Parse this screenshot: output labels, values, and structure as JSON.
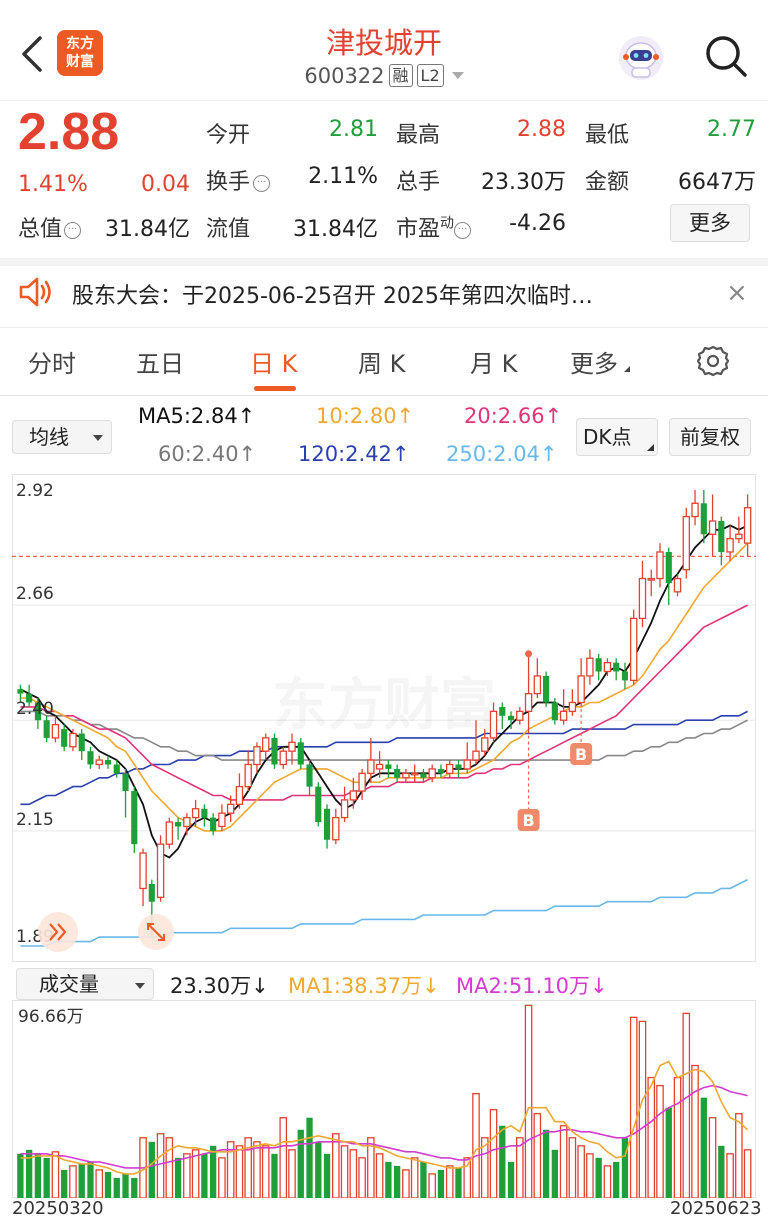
{
  "header": {
    "logo_line1": "东方",
    "logo_line2": "财富",
    "title": "津投城开",
    "code": "600322",
    "tag1": "融",
    "tag2": "L2"
  },
  "quote": {
    "price": "2.88",
    "change_pct": "1.41%",
    "change_amt": "0.04",
    "open_label": "今开",
    "open": "2.81",
    "high_label": "最高",
    "high": "2.88",
    "low_label": "最低",
    "low": "2.77",
    "turnover_label": "换手",
    "turnover": "2.11%",
    "volume_label": "总手",
    "volume": "23.30万",
    "amount_label": "金额",
    "amount": "6647万",
    "mktcap_label": "总值",
    "mktcap": "31.84亿",
    "float_label": "流值",
    "float": "31.84亿",
    "pe_label": "市盈",
    "pe_sup": "动",
    "pe": "-4.26",
    "more_label": "更多"
  },
  "notice": {
    "text": "股东大会：于2025-06-25召开 2025年第四次临时…",
    "close": "×"
  },
  "tabs": [
    {
      "label": "分时"
    },
    {
      "label": "五日"
    },
    {
      "label": "日 K"
    },
    {
      "label": "周 K"
    },
    {
      "label": "月 K"
    },
    {
      "label": "更多"
    }
  ],
  "ma_bar": {
    "select_label": "均线",
    "ma5": "MA5:2.84↑",
    "ma10": "10:2.80↑",
    "ma20": "20:2.66↑",
    "ma60": "60:2.40↑",
    "ma120": "120:2.42↑",
    "ma250": "250:2.04↑",
    "dk_label": "DK点",
    "fq_label": "前复权",
    "colors": {
      "ma5": "#111111",
      "ma10": "#f0a830",
      "ma20": "#e0337a",
      "ma60": "#888888",
      "ma120": "#2b3fae",
      "ma250": "#6ab8ea"
    }
  },
  "chart_data": {
    "type": "candlestick",
    "y_ticks": [
      "2.92",
      "2.66",
      "2.40",
      "2.15",
      "1.89"
    ],
    "ylim": [
      1.89,
      2.92
    ],
    "current_price": 2.77,
    "watermark": "东方财富",
    "marker_label": "B",
    "candles": [
      [
        2.47,
        2.46,
        2.48,
        2.44
      ],
      [
        2.46,
        2.44,
        2.48,
        2.43
      ],
      [
        2.44,
        2.4,
        2.45,
        2.38
      ],
      [
        2.4,
        2.36,
        2.41,
        2.35
      ],
      [
        2.36,
        2.39,
        2.41,
        2.35
      ],
      [
        2.38,
        2.34,
        2.39,
        2.33
      ],
      [
        2.34,
        2.37,
        2.38,
        2.33
      ],
      [
        2.37,
        2.33,
        2.38,
        2.31
      ],
      [
        2.33,
        2.3,
        2.34,
        2.29
      ],
      [
        2.3,
        2.31,
        2.32,
        2.29
      ],
      [
        2.31,
        2.3,
        2.32,
        2.29
      ],
      [
        2.3,
        2.28,
        2.31,
        2.27
      ],
      [
        2.28,
        2.24,
        2.29,
        2.18
      ],
      [
        2.24,
        2.12,
        2.25,
        2.1
      ],
      [
        2.02,
        2.1,
        2.11,
        1.98
      ],
      [
        2.03,
        1.99,
        2.04,
        1.91
      ],
      [
        2.0,
        2.12,
        2.14,
        1.99
      ],
      [
        2.12,
        2.17,
        2.18,
        2.11
      ],
      [
        2.17,
        2.16,
        2.18,
        2.13
      ],
      [
        2.16,
        2.18,
        2.19,
        2.14
      ],
      [
        2.18,
        2.2,
        2.22,
        2.16
      ],
      [
        2.2,
        2.18,
        2.21,
        2.16
      ],
      [
        2.18,
        2.15,
        2.19,
        2.14
      ],
      [
        2.16,
        2.19,
        2.21,
        2.15
      ],
      [
        2.19,
        2.21,
        2.23,
        2.17
      ],
      [
        2.21,
        2.25,
        2.28,
        2.2
      ],
      [
        2.25,
        2.3,
        2.33,
        2.24
      ],
      [
        2.3,
        2.34,
        2.35,
        2.28
      ],
      [
        2.33,
        2.36,
        2.37,
        2.31
      ],
      [
        2.36,
        2.3,
        2.37,
        2.29
      ],
      [
        2.3,
        2.33,
        2.34,
        2.29
      ],
      [
        2.33,
        2.35,
        2.37,
        2.3
      ],
      [
        2.35,
        2.3,
        2.36,
        2.29
      ],
      [
        2.3,
        2.25,
        2.31,
        2.23
      ],
      [
        2.25,
        2.17,
        2.26,
        2.16
      ],
      [
        2.2,
        2.13,
        2.21,
        2.11
      ],
      [
        2.13,
        2.18,
        2.2,
        2.12
      ],
      [
        2.18,
        2.22,
        2.25,
        2.17
      ],
      [
        2.22,
        2.24,
        2.27,
        2.2
      ],
      [
        2.24,
        2.28,
        2.29,
        2.22
      ],
      [
        2.28,
        2.31,
        2.36,
        2.26
      ],
      [
        2.29,
        2.3,
        2.33,
        2.27
      ],
      [
        2.3,
        2.29,
        2.31,
        2.27
      ],
      [
        2.29,
        2.27,
        2.3,
        2.26
      ],
      [
        2.27,
        2.28,
        2.29,
        2.26
      ],
      [
        2.28,
        2.28,
        2.3,
        2.26
      ],
      [
        2.28,
        2.27,
        2.29,
        2.26
      ],
      [
        2.27,
        2.29,
        2.3,
        2.26
      ],
      [
        2.29,
        2.28,
        2.3,
        2.27
      ],
      [
        2.28,
        2.3,
        2.31,
        2.27
      ],
      [
        2.3,
        2.29,
        2.31,
        2.27
      ],
      [
        2.29,
        2.31,
        2.35,
        2.28
      ],
      [
        2.31,
        2.33,
        2.4,
        2.3
      ],
      [
        2.33,
        2.36,
        2.38,
        2.32
      ],
      [
        2.36,
        2.42,
        2.44,
        2.35
      ],
      [
        2.43,
        2.41,
        2.44,
        2.38
      ],
      [
        2.41,
        2.4,
        2.42,
        2.38
      ],
      [
        2.4,
        2.42,
        2.43,
        2.39
      ],
      [
        2.42,
        2.46,
        2.55,
        2.37
      ],
      [
        2.46,
        2.5,
        2.54,
        2.45
      ],
      [
        2.5,
        2.44,
        2.51,
        2.43
      ],
      [
        2.44,
        2.4,
        2.45,
        2.39
      ],
      [
        2.4,
        2.42,
        2.47,
        2.39
      ],
      [
        2.42,
        2.44,
        2.47,
        2.41
      ],
      [
        2.44,
        2.5,
        2.54,
        2.43
      ],
      [
        2.5,
        2.54,
        2.56,
        2.48
      ],
      [
        2.54,
        2.51,
        2.55,
        2.49
      ],
      [
        2.51,
        2.53,
        2.54,
        2.5
      ],
      [
        2.53,
        2.51,
        2.54,
        2.49
      ],
      [
        2.51,
        2.49,
        2.53,
        2.47
      ],
      [
        2.49,
        2.63,
        2.65,
        2.48
      ],
      [
        2.63,
        2.72,
        2.76,
        2.61
      ],
      [
        2.72,
        2.72,
        2.74,
        2.68
      ],
      [
        2.72,
        2.78,
        2.8,
        2.7
      ],
      [
        2.78,
        2.71,
        2.79,
        2.66
      ],
      [
        2.69,
        2.72,
        2.73,
        2.68
      ],
      [
        2.74,
        2.86,
        2.88,
        2.72
      ],
      [
        2.86,
        2.89,
        2.92,
        2.84
      ],
      [
        2.89,
        2.82,
        2.92,
        2.8
      ],
      [
        2.82,
        2.85,
        2.91,
        2.77
      ],
      [
        2.85,
        2.78,
        2.86,
        2.75
      ],
      [
        2.78,
        2.81,
        2.84,
        2.76
      ],
      [
        2.81,
        2.82,
        2.86,
        2.8
      ],
      [
        2.8,
        2.88,
        2.91,
        2.77
      ]
    ],
    "ma5": [
      2.47,
      2.46,
      2.45,
      2.42,
      2.41,
      2.39,
      2.37,
      2.36,
      2.35,
      2.33,
      2.32,
      2.31,
      2.29,
      2.25,
      2.21,
      2.14,
      2.1,
      2.09,
      2.11,
      2.15,
      2.17,
      2.18,
      2.17,
      2.18,
      2.19,
      2.21,
      2.24,
      2.28,
      2.31,
      2.33,
      2.34,
      2.34,
      2.34,
      2.31,
      2.28,
      2.25,
      2.22,
      2.2,
      2.21,
      2.24,
      2.27,
      2.28,
      2.28,
      2.28,
      2.28,
      2.28,
      2.28,
      2.28,
      2.28,
      2.29,
      2.29,
      2.29,
      2.3,
      2.32,
      2.35,
      2.37,
      2.39,
      2.41,
      2.42,
      2.44,
      2.44,
      2.44,
      2.43,
      2.43,
      2.44,
      2.46,
      2.48,
      2.51,
      2.52,
      2.51,
      2.54,
      2.58,
      2.62,
      2.67,
      2.71,
      2.73,
      2.76,
      2.79,
      2.81,
      2.83,
      2.83,
      2.84,
      2.83,
      2.84
    ],
    "ma10": [
      2.45,
      2.45,
      2.44,
      2.43,
      2.42,
      2.41,
      2.4,
      2.39,
      2.38,
      2.37,
      2.36,
      2.34,
      2.33,
      2.3,
      2.27,
      2.24,
      2.22,
      2.2,
      2.18,
      2.17,
      2.16,
      2.15,
      2.15,
      2.15,
      2.16,
      2.18,
      2.2,
      2.22,
      2.24,
      2.26,
      2.27,
      2.28,
      2.29,
      2.29,
      2.29,
      2.29,
      2.28,
      2.27,
      2.26,
      2.26,
      2.26,
      2.26,
      2.27,
      2.27,
      2.27,
      2.27,
      2.27,
      2.27,
      2.27,
      2.28,
      2.28,
      2.28,
      2.29,
      2.3,
      2.31,
      2.33,
      2.35,
      2.36,
      2.38,
      2.39,
      2.4,
      2.41,
      2.42,
      2.43,
      2.43,
      2.44,
      2.44,
      2.45,
      2.46,
      2.47,
      2.48,
      2.5,
      2.53,
      2.56,
      2.58,
      2.61,
      2.64,
      2.67,
      2.7,
      2.72,
      2.74,
      2.76,
      2.78,
      2.8
    ],
    "ma20": [
      2.43,
      2.43,
      2.43,
      2.42,
      2.42,
      2.41,
      2.41,
      2.4,
      2.39,
      2.38,
      2.38,
      2.37,
      2.36,
      2.34,
      2.32,
      2.3,
      2.29,
      2.28,
      2.27,
      2.26,
      2.25,
      2.24,
      2.23,
      2.23,
      2.22,
      2.22,
      2.22,
      2.22,
      2.22,
      2.22,
      2.22,
      2.23,
      2.23,
      2.23,
      2.23,
      2.23,
      2.23,
      2.23,
      2.24,
      2.24,
      2.25,
      2.25,
      2.25,
      2.26,
      2.26,
      2.26,
      2.26,
      2.27,
      2.27,
      2.27,
      2.27,
      2.27,
      2.28,
      2.28,
      2.29,
      2.29,
      2.3,
      2.3,
      2.31,
      2.32,
      2.33,
      2.34,
      2.35,
      2.36,
      2.37,
      2.38,
      2.39,
      2.4,
      2.41,
      2.43,
      2.45,
      2.47,
      2.49,
      2.51,
      2.53,
      2.55,
      2.57,
      2.59,
      2.61,
      2.62,
      2.63,
      2.64,
      2.65,
      2.66
    ],
    "ma60": [
      2.42,
      2.42,
      2.42,
      2.41,
      2.41,
      2.41,
      2.4,
      2.4,
      2.39,
      2.39,
      2.38,
      2.38,
      2.37,
      2.36,
      2.36,
      2.35,
      2.34,
      2.34,
      2.33,
      2.33,
      2.32,
      2.32,
      2.32,
      2.31,
      2.31,
      2.31,
      2.31,
      2.31,
      2.31,
      2.31,
      2.31,
      2.31,
      2.31,
      2.31,
      2.31,
      2.31,
      2.31,
      2.31,
      2.31,
      2.31,
      2.31,
      2.31,
      2.31,
      2.31,
      2.31,
      2.31,
      2.31,
      2.31,
      2.31,
      2.31,
      2.31,
      2.31,
      2.31,
      2.31,
      2.31,
      2.31,
      2.31,
      2.31,
      2.31,
      2.31,
      2.31,
      2.31,
      2.31,
      2.31,
      2.31,
      2.31,
      2.31,
      2.32,
      2.32,
      2.32,
      2.33,
      2.33,
      2.34,
      2.34,
      2.35,
      2.35,
      2.36,
      2.36,
      2.37,
      2.37,
      2.38,
      2.38,
      2.39,
      2.4
    ],
    "ma120": [
      2.21,
      2.21,
      2.22,
      2.23,
      2.23,
      2.24,
      2.25,
      2.25,
      2.26,
      2.27,
      2.27,
      2.28,
      2.28,
      2.29,
      2.29,
      2.3,
      2.3,
      2.3,
      2.31,
      2.31,
      2.31,
      2.32,
      2.32,
      2.32,
      2.32,
      2.33,
      2.33,
      2.33,
      2.33,
      2.34,
      2.34,
      2.34,
      2.34,
      2.34,
      2.34,
      2.34,
      2.35,
      2.35,
      2.35,
      2.35,
      2.35,
      2.35,
      2.35,
      2.36,
      2.36,
      2.36,
      2.36,
      2.36,
      2.36,
      2.36,
      2.36,
      2.36,
      2.36,
      2.37,
      2.37,
      2.37,
      2.37,
      2.37,
      2.37,
      2.37,
      2.37,
      2.37,
      2.37,
      2.38,
      2.38,
      2.38,
      2.38,
      2.38,
      2.38,
      2.38,
      2.39,
      2.39,
      2.39,
      2.39,
      2.39,
      2.39,
      2.4,
      2.4,
      2.4,
      2.4,
      2.41,
      2.41,
      2.41,
      2.42
    ],
    "ma250": [
      1.89,
      1.89,
      1.89,
      1.89,
      1.9,
      1.9,
      1.9,
      1.9,
      1.9,
      1.91,
      1.91,
      1.91,
      1.91,
      1.91,
      1.91,
      1.91,
      1.91,
      1.92,
      1.92,
      1.92,
      1.92,
      1.92,
      1.92,
      1.92,
      1.93,
      1.93,
      1.93,
      1.93,
      1.93,
      1.93,
      1.93,
      1.93,
      1.94,
      1.94,
      1.94,
      1.94,
      1.94,
      1.94,
      1.94,
      1.95,
      1.95,
      1.95,
      1.95,
      1.95,
      1.95,
      1.95,
      1.96,
      1.96,
      1.96,
      1.96,
      1.96,
      1.96,
      1.96,
      1.96,
      1.97,
      1.97,
      1.97,
      1.97,
      1.97,
      1.97,
      1.97,
      1.98,
      1.98,
      1.98,
      1.98,
      1.98,
      1.98,
      1.99,
      1.99,
      1.99,
      1.99,
      1.99,
      1.99,
      2.0,
      2.0,
      2.0,
      2.0,
      2.01,
      2.01,
      2.01,
      2.02,
      2.02,
      2.03,
      2.04
    ]
  },
  "volume_bar": {
    "select_label": "成交量",
    "vol": "23.30万↓",
    "ma1": "MA1:38.37万↓",
    "ma2": "MA2:51.10万↓",
    "max_label": "96.66万",
    "date_start": "20250320",
    "date_end": "20250623",
    "colors": {
      "ma1": "#f0a830",
      "ma2": "#d43cd0"
    }
  },
  "volume_data": {
    "ymax": 96.66,
    "values": [
      22,
      24,
      22,
      20,
      23,
      14,
      16,
      17,
      18,
      14,
      13,
      10,
      12,
      10,
      30,
      28,
      32,
      30,
      20,
      22,
      24,
      22,
      26,
      20,
      28,
      26,
      30,
      28,
      26,
      22,
      40,
      24,
      34,
      40,
      28,
      22,
      32,
      26,
      24,
      20,
      30,
      22,
      18,
      16,
      14,
      20,
      18,
      12,
      14,
      16,
      15,
      20,
      52,
      30,
      44,
      36,
      18,
      30,
      96,
      42,
      34,
      24,
      36,
      30,
      26,
      22,
      20,
      16,
      18,
      30,
      90,
      88,
      60,
      56,
      45,
      60,
      92,
      66,
      50,
      40,
      26,
      22,
      42,
      24
    ],
    "ma1": [
      20,
      20,
      21,
      21,
      21,
      19,
      18,
      17,
      17,
      16,
      15,
      13,
      12,
      12,
      14,
      17,
      21,
      24,
      26,
      25,
      25,
      24,
      23,
      23,
      23,
      24,
      25,
      26,
      27,
      26,
      28,
      28,
      29,
      30,
      31,
      30,
      29,
      28,
      28,
      26,
      26,
      25,
      23,
      21,
      20,
      19,
      18,
      17,
      16,
      15,
      15,
      16,
      24,
      26,
      30,
      34,
      36,
      33,
      45,
      45,
      45,
      38,
      38,
      33,
      30,
      28,
      27,
      23,
      20,
      21,
      35,
      49,
      56,
      66,
      68,
      60,
      62,
      64,
      63,
      58,
      48,
      40,
      38,
      34
    ],
    "ma2": [
      22,
      22,
      22,
      22,
      21,
      21,
      20,
      19,
      18,
      18,
      17,
      16,
      15,
      15,
      15,
      16,
      17,
      18,
      19,
      20,
      21,
      22,
      23,
      24,
      24,
      24,
      24,
      25,
      25,
      25,
      26,
      26,
      27,
      27,
      28,
      28,
      28,
      28,
      27,
      27,
      27,
      26,
      25,
      24,
      23,
      23,
      22,
      21,
      20,
      20,
      19,
      19,
      21,
      22,
      24,
      25,
      26,
      26,
      29,
      31,
      33,
      33,
      34,
      34,
      33,
      33,
      32,
      31,
      30,
      30,
      32,
      35,
      38,
      42,
      45,
      47,
      50,
      53,
      55,
      56,
      55,
      53,
      52,
      51
    ]
  }
}
